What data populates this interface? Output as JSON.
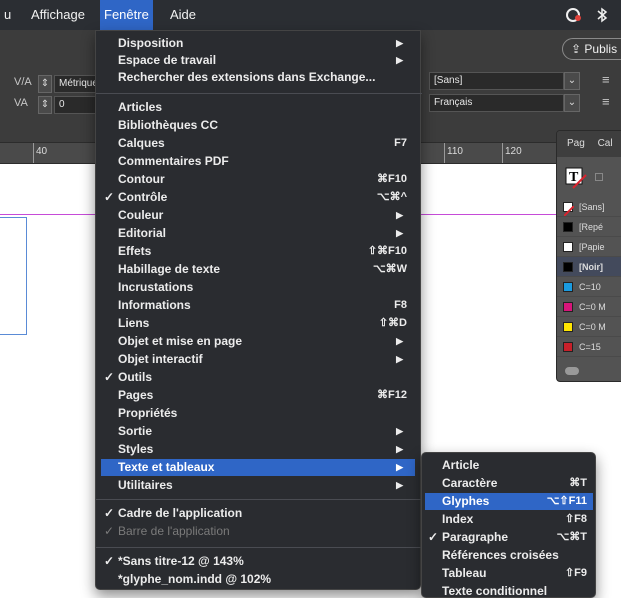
{
  "menubar": {
    "items": [
      {
        "label": "u"
      },
      {
        "label": "Affichage"
      },
      {
        "label": "Fenêtre"
      },
      {
        "label": "Aide"
      }
    ],
    "icons": [
      "creative-cloud-icon",
      "bluetooth-icon"
    ]
  },
  "controlbar": {
    "publish_label": "Publis",
    "tracking_value": "Métrique",
    "kerning_value": "0",
    "char_style_value": "[Sans]",
    "language_value": "Français"
  },
  "ruler": {
    "labels": [
      "40",
      "110",
      "120"
    ]
  },
  "swatches": {
    "tabs": [
      "Pag",
      "Cal"
    ],
    "items": [
      {
        "name": "[Sans]",
        "color": "#ffffff"
      },
      {
        "name": "[Repé",
        "color": "#000000"
      },
      {
        "name": "[Papie",
        "color": "#ffffff"
      },
      {
        "name": "[Noir]",
        "color": "#000000"
      },
      {
        "name": "C=10",
        "color": "#1a9be0"
      },
      {
        "name": "C=0 M",
        "color": "#d8157a"
      },
      {
        "name": "C=0 M",
        "color": "#ffe500"
      },
      {
        "name": "C=15",
        "color": "#c8202a"
      }
    ]
  },
  "menu": {
    "items": [
      {
        "label": "Disposition",
        "check": "",
        "shortcut": "",
        "submenu": true
      },
      {
        "label": "Espace de travail",
        "check": "",
        "shortcut": "",
        "submenu": true
      },
      {
        "label": "Rechercher des extensions dans Exchange...",
        "check": "",
        "shortcut": "",
        "submenu": false
      },
      {
        "label": "Articles",
        "check": "",
        "shortcut": "",
        "submenu": false
      },
      {
        "label": "Bibliothèques CC",
        "check": "",
        "shortcut": "",
        "submenu": false
      },
      {
        "label": "Calques",
        "check": "",
        "shortcut": "F7",
        "submenu": false
      },
      {
        "label": "Commentaires PDF",
        "check": "",
        "shortcut": "",
        "submenu": false
      },
      {
        "label": "Contour",
        "check": "",
        "shortcut": "⌘F10",
        "submenu": false
      },
      {
        "label": "Contrôle",
        "check": "✓",
        "shortcut": "⌥⌘^",
        "submenu": false
      },
      {
        "label": "Couleur",
        "check": "",
        "shortcut": "",
        "submenu": true
      },
      {
        "label": "Editorial",
        "check": "",
        "shortcut": "",
        "submenu": true
      },
      {
        "label": "Effets",
        "check": "",
        "shortcut": "⇧⌘F10",
        "submenu": false
      },
      {
        "label": "Habillage de texte",
        "check": "",
        "shortcut": "⌥⌘W",
        "submenu": false
      },
      {
        "label": "Incrustations",
        "check": "",
        "shortcut": "",
        "submenu": false
      },
      {
        "label": "Informations",
        "check": "",
        "shortcut": "F8",
        "submenu": false
      },
      {
        "label": "Liens",
        "check": "",
        "shortcut": "⇧⌘D",
        "submenu": false
      },
      {
        "label": "Objet et mise en page",
        "check": "",
        "shortcut": "",
        "submenu": true
      },
      {
        "label": "Objet interactif",
        "check": "",
        "shortcut": "",
        "submenu": true
      },
      {
        "label": "Outils",
        "check": "✓",
        "shortcut": "",
        "submenu": false
      },
      {
        "label": "Pages",
        "check": "",
        "shortcut": "⌘F12",
        "submenu": false
      },
      {
        "label": "Propriétés",
        "check": "",
        "shortcut": "",
        "submenu": false
      },
      {
        "label": "Sortie",
        "check": "",
        "shortcut": "",
        "submenu": true
      },
      {
        "label": "Styles",
        "check": "",
        "shortcut": "",
        "submenu": true
      },
      {
        "label": "Texte et tableaux",
        "check": "",
        "shortcut": "",
        "submenu": true,
        "active": true
      },
      {
        "label": "Utilitaires",
        "check": "",
        "shortcut": "",
        "submenu": true
      },
      {
        "label": "Cadre de l'application",
        "check": "✓",
        "shortcut": "",
        "submenu": false
      },
      {
        "label": "Barre de l'application",
        "check": "✓",
        "shortcut": "",
        "submenu": false,
        "disabled": true
      },
      {
        "label": "*Sans titre-12 @ 143%",
        "check": "✓",
        "shortcut": "",
        "submenu": false
      },
      {
        "label": "*glyphe_nom.indd @ 102%",
        "check": "",
        "shortcut": "",
        "submenu": false
      }
    ]
  },
  "submenu": {
    "items": [
      {
        "label": "Article",
        "check": "",
        "shortcut": ""
      },
      {
        "label": "Caractère",
        "check": "",
        "shortcut": "⌘T"
      },
      {
        "label": "Glyphes",
        "check": "",
        "shortcut": "⌥⇧F11",
        "active": true
      },
      {
        "label": "Index",
        "check": "",
        "shortcut": "⇧F8"
      },
      {
        "label": "Paragraphe",
        "check": "✓",
        "shortcut": "⌥⌘T"
      },
      {
        "label": "Références croisées",
        "check": "",
        "shortcut": ""
      },
      {
        "label": "Tableau",
        "check": "",
        "shortcut": "⇧F9"
      },
      {
        "label": "Texte conditionnel",
        "check": "",
        "shortcut": ""
      }
    ]
  },
  "colors": {
    "menubar_bg": "#2b2e33",
    "menu_bg": "#2a2c30",
    "highlight": "#2f66c6",
    "guide": "#c64bd8"
  }
}
